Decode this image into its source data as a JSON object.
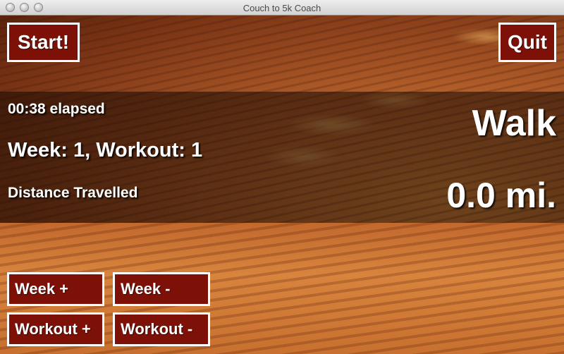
{
  "window": {
    "title": "Couch to 5k Coach"
  },
  "controls": {
    "start_label": "Start!",
    "quit_label": "Quit",
    "week_plus_label": "Week +",
    "week_minus_label": "Week -",
    "workout_plus_label": "Workout +",
    "workout_minus_label": "Workout -"
  },
  "status": {
    "elapsed": "00:38 elapsed",
    "week_workout": "Week: 1, Workout: 1",
    "distance_label": "Distance Travelled",
    "phase": "Walk",
    "distance_value": "0.0 mi."
  },
  "colors": {
    "button_fill": "#7d1108",
    "button_border": "#ffffff",
    "text": "#ffffff"
  }
}
